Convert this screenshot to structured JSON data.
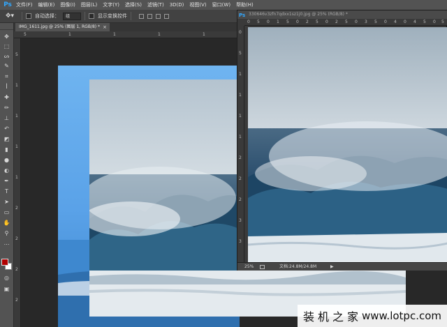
{
  "app": {
    "logo": "Ps",
    "menu": [
      "文件(F)",
      "编辑(E)",
      "图像(I)",
      "图层(L)",
      "文字(Y)",
      "选择(S)",
      "滤镜(T)",
      "3D(D)",
      "视图(V)",
      "窗口(W)",
      "帮助(H)"
    ]
  },
  "options": {
    "tool_icon": "move-tool-icon",
    "auto_select_label": "自动选择：",
    "auto_select_checked": false,
    "auto_select_value": "组",
    "show_transform_label": "显示变换控件",
    "show_transform_checked": false
  },
  "document1": {
    "tab_title": "IMG_1611.jpg @ 25% (图层 1, RGB/8) *",
    "tab_close": "×",
    "ruler_h": [
      "5",
      "1",
      "1",
      "1",
      "1"
    ],
    "ruler_v": [
      "5",
      "1",
      "1",
      "1",
      "1",
      "2",
      "2",
      "2",
      "2"
    ]
  },
  "document2": {
    "title": "330646v3zfn7qdxx1sz1j0.jpg @ 25% (RGB/8) *",
    "ruler_h": [
      "0",
      "5",
      "0",
      "1",
      "5",
      "0",
      "2",
      "5",
      "0",
      "2",
      "5",
      "0",
      "3",
      "5",
      "0",
      "4",
      "0",
      "4",
      "5",
      "0",
      "5"
    ],
    "ruler_v": [
      "0",
      "5",
      "1",
      "1",
      "1",
      "1",
      "2",
      "2",
      "2",
      "3",
      "3"
    ],
    "status_zoom": "25%",
    "status_doc": "文档:24.8M/24.8M",
    "status_arrow": "▶"
  },
  "watermark": {
    "chinese": "装机之家",
    "url": "www.lotpc.com"
  },
  "colors": {
    "foreground": "#b10000",
    "background": "#ffffff",
    "accent": "#31a8ff"
  },
  "tools": [
    "move-tool-icon",
    "marquee-tool-icon",
    "lasso-tool-icon",
    "quick-select-tool-icon",
    "crop-tool-icon",
    "eyedropper-tool-icon",
    "healing-brush-icon",
    "brush-tool-icon",
    "clone-stamp-icon",
    "history-brush-icon",
    "eraser-tool-icon",
    "gradient-tool-icon",
    "blur-tool-icon",
    "dodge-tool-icon",
    "pen-tool-icon",
    "type-tool-icon",
    "path-select-icon",
    "rectangle-tool-icon",
    "hand-tool-icon",
    "zoom-tool-icon"
  ]
}
